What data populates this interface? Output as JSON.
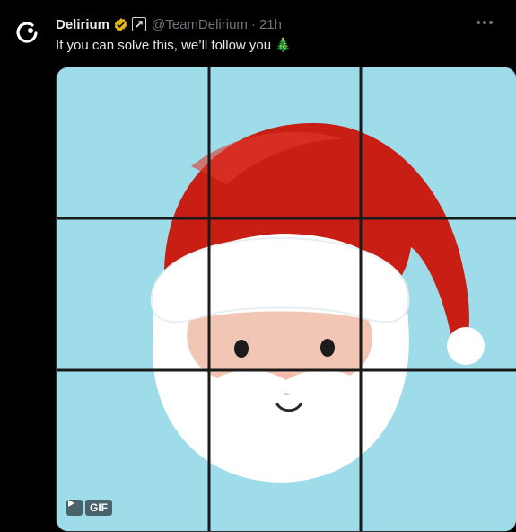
{
  "tweet": {
    "display_name": "Delirium",
    "handle": "@TeamDelirium",
    "separator": "·",
    "time": "21h",
    "text": "If you can solve this, we’ll follow you 🎄",
    "icons": {
      "avatar": "delirium-logo",
      "verified": "gold-verified-badge-icon",
      "affiliate": "affiliate-badge-icon",
      "more": "more-options-icon"
    }
  },
  "media": {
    "type": "gif",
    "description_icon": "santa-face-puzzle",
    "grid": "3x3",
    "gif_label": "GIF",
    "colors": {
      "background": "#9fdcea",
      "hat_red": "#c81e14",
      "beard_white": "#ffffff",
      "face_skin": "#f2c6b4",
      "grid_lines": "#1a1a1a"
    }
  }
}
